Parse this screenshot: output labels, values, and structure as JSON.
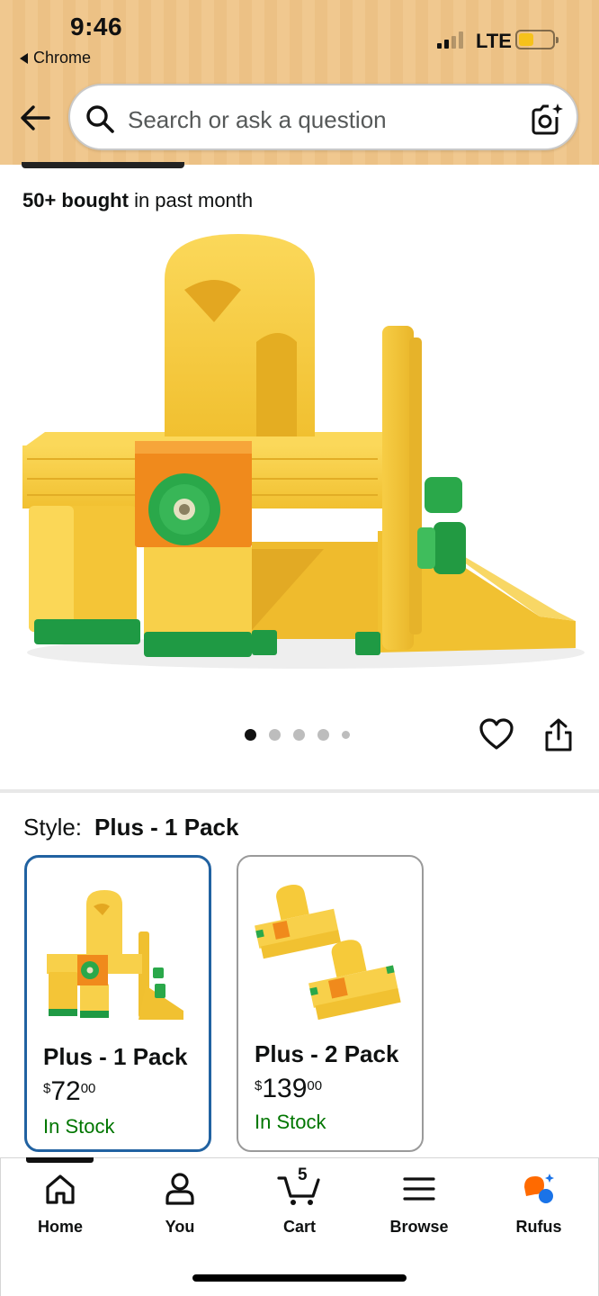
{
  "status_bar": {
    "time": "9:46",
    "back_app": "Chrome",
    "network": "LTE"
  },
  "search": {
    "placeholder": "Search or ask a question"
  },
  "bought": {
    "count": "50+ bought",
    "suffix": " in past month"
  },
  "carousel": {
    "total_images": 5,
    "active_index": 0
  },
  "style": {
    "label": "Style:",
    "selected": "Plus - 1 Pack",
    "options": [
      {
        "name": "Plus - 1 Pack",
        "currency": "$",
        "whole": "72",
        "fraction": "00",
        "stock": "In Stock"
      },
      {
        "name": "Plus - 2 Pack",
        "currency": "$",
        "whole": "139",
        "fraction": "00",
        "stock": "In Stock"
      }
    ]
  },
  "bottom_nav": {
    "items": [
      {
        "label": "Home",
        "icon": "home-icon"
      },
      {
        "label": "You",
        "icon": "person-icon"
      },
      {
        "label": "Cart",
        "icon": "cart-icon"
      },
      {
        "label": "Browse",
        "icon": "menu-icon"
      },
      {
        "label": "Rufus",
        "icon": "rufus-icon"
      }
    ],
    "cart_count": "5"
  },
  "colors": {
    "header_bg": "#f0c88f",
    "selected_border": "#2162a1",
    "in_stock": "#007600",
    "product_yellow": "#f5c93a",
    "product_orange": "#f08a1c",
    "product_green": "#2aa84a"
  }
}
